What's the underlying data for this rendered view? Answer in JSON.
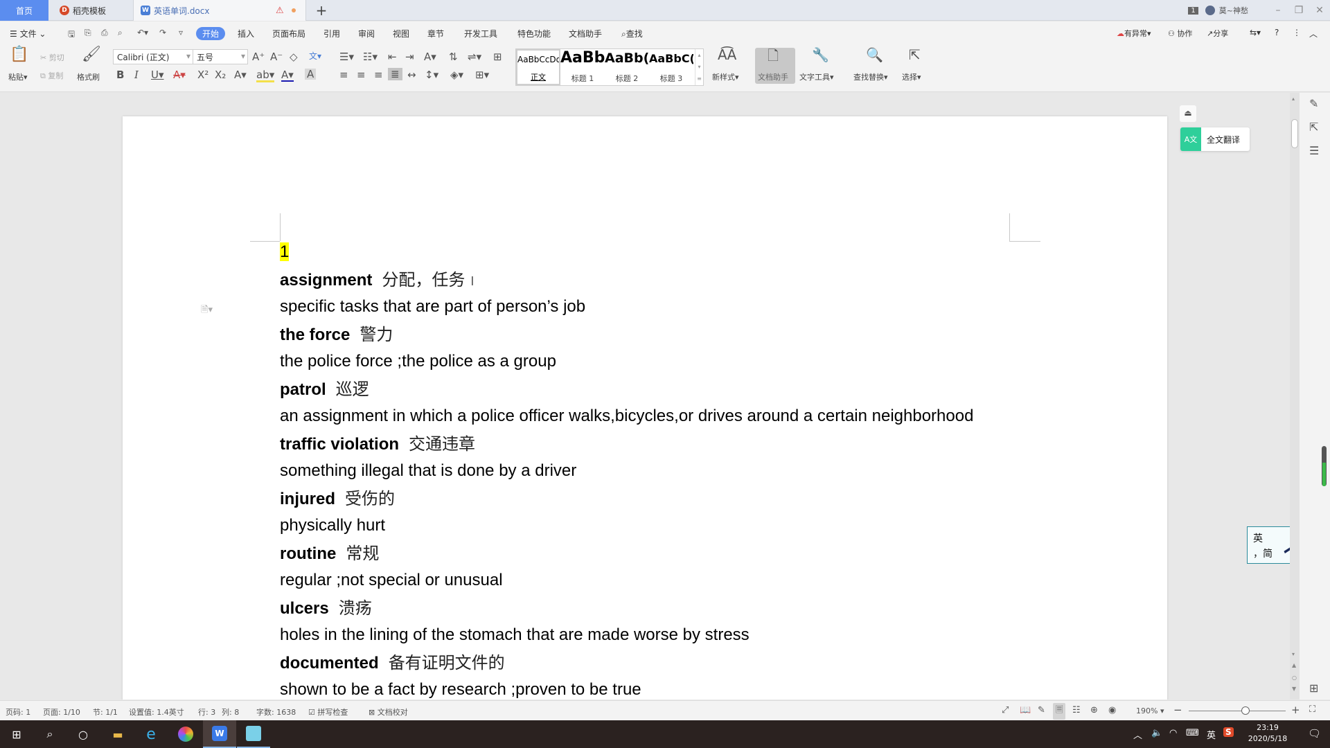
{
  "tabs": {
    "home": "首页",
    "template": "稻壳模板",
    "document": "英语单词.docx",
    "new_tab": "+"
  },
  "titlebar": {
    "badge": "1",
    "user": "莫~神愁",
    "minimize": "–",
    "restore": "❐",
    "close": "✕"
  },
  "menu": {
    "file": "文件",
    "items": [
      "开始",
      "插入",
      "页面布局",
      "引用",
      "审阅",
      "视图",
      "章节",
      "开发工具",
      "特色功能",
      "文档助手"
    ],
    "search": "查找",
    "right": {
      "issues": "有异常",
      "collab": "协作",
      "share": "分享"
    }
  },
  "ribbon": {
    "paste": "粘贴",
    "cut": "剪切",
    "copy": "复制",
    "format_painter": "格式刷",
    "font_name": "Calibri (正文)",
    "font_size": "五号",
    "styles": [
      {
        "preview": "AaBbCcDd",
        "label": "正文"
      },
      {
        "preview": "AaBb",
        "label": "标题 1"
      },
      {
        "preview": "AaBb(",
        "label": "标题 2"
      },
      {
        "preview": "AaBbC(",
        "label": "标题 3"
      }
    ],
    "new_style": "新样式",
    "doc_assistant": "文档助手",
    "text_tools": "文字工具",
    "find_replace": "查找替换",
    "select": "选择"
  },
  "side": {
    "translate": "全文翻译",
    "ime_line1": "英",
    "ime_line2": "，简"
  },
  "document": {
    "number": "1",
    "entries": [
      {
        "term": "assignment",
        "zh": "分配，任务",
        "def": "specific tasks that are part of person’s job"
      },
      {
        "term": "the force",
        "zh": "警力",
        "def": "the police force ;the police as a group"
      },
      {
        "term": "patrol",
        "zh": "巡逻",
        "def": "an assignment in which a police officer walks,bicycles,or drives around a certain neighborhood"
      },
      {
        "term": "traffic violation",
        "zh": "交通违章",
        "def": "something illegal that is done by a driver"
      },
      {
        "term": "injured",
        "zh": "受伤的",
        "def": "physically hurt"
      },
      {
        "term": "routine",
        "zh": "常规",
        "def": "regular ;not special or unusual"
      },
      {
        "term": "ulcers",
        "zh": "溃疡",
        "def": "holes in the lining of the stomach that are made worse by stress"
      },
      {
        "term": "documented",
        "zh": "备有证明文件的",
        "def": "shown to be a fact by research ;proven to be true"
      }
    ]
  },
  "status": {
    "page_num": "页码: 1",
    "pages": "页面: 1/10",
    "section": "节: 1/1",
    "setting": "设置值: 1.4英寸",
    "row": "行: 3",
    "col": "列: 8",
    "word_count": "字数: 1638",
    "spellcheck": "拼写检查",
    "proofread": "文档校对",
    "zoom": "190%"
  },
  "taskbar": {
    "time": "23:19",
    "date": "2020/5/18",
    "ime": "英"
  }
}
